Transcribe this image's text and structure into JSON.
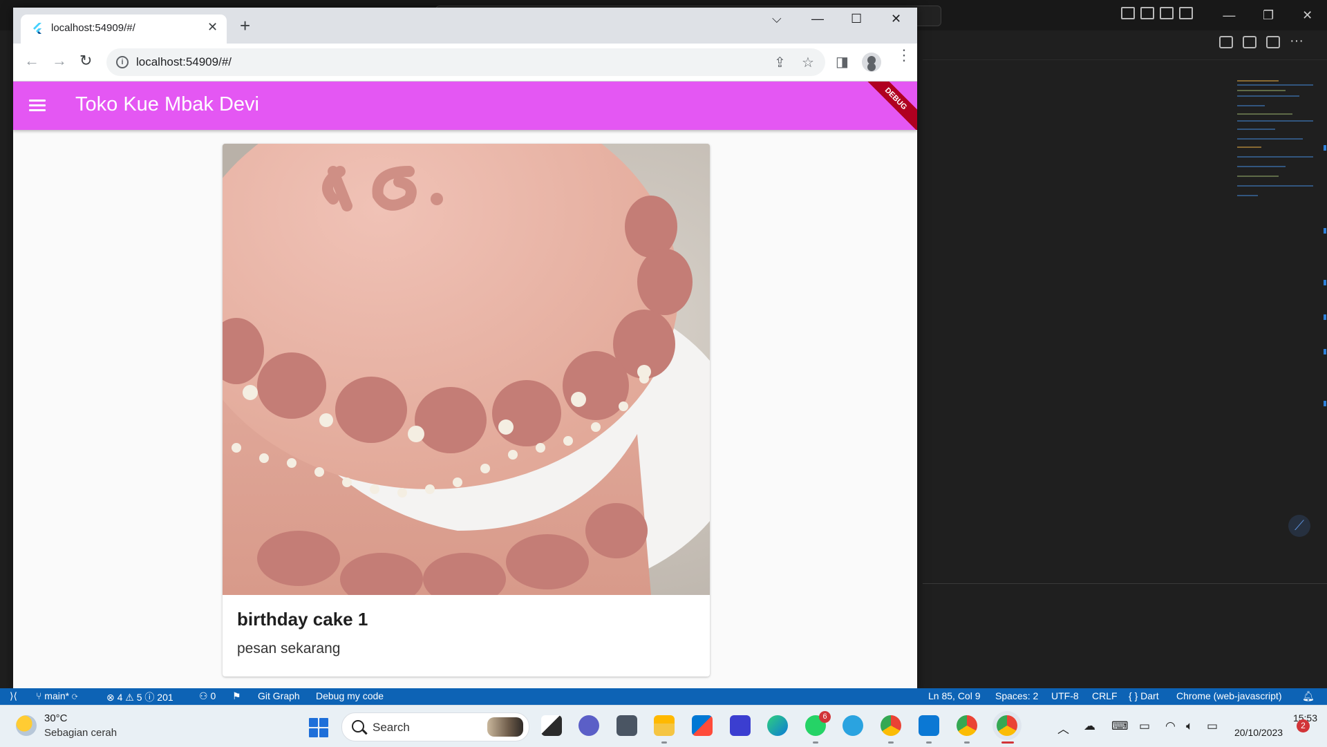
{
  "browser": {
    "tab_title": "localhost:54909/#/",
    "url": "localhost:54909/#/"
  },
  "app": {
    "title": "Toko Kue Mbak Devi",
    "debug_label": "DEBUG",
    "card": {
      "title": "birthday cake 1",
      "subtitle": "pesan sekarang",
      "image_icon": "birthday-cake-photo"
    },
    "colors": {
      "appbar": "#e457f3"
    }
  },
  "statusbar": {
    "branch": "main*",
    "problems": "⊗ 4 ⚠ 5 ⓘ 201",
    "ports": "0",
    "git_graph": "Git Graph",
    "debug": "Debug my code",
    "cursor": "Ln 85, Col 9",
    "spaces": "Spaces: 2",
    "encoding": "UTF-8",
    "eol": "CRLF",
    "language": "{ } Dart",
    "target": "Chrome (web-javascript)"
  },
  "taskbar": {
    "temperature": "30°C",
    "weather": "Sebagian cerah",
    "search_placeholder": "Search",
    "whatsapp_badge": "6",
    "time": "15:53",
    "date": "20/10/2023",
    "notifications": "2"
  }
}
